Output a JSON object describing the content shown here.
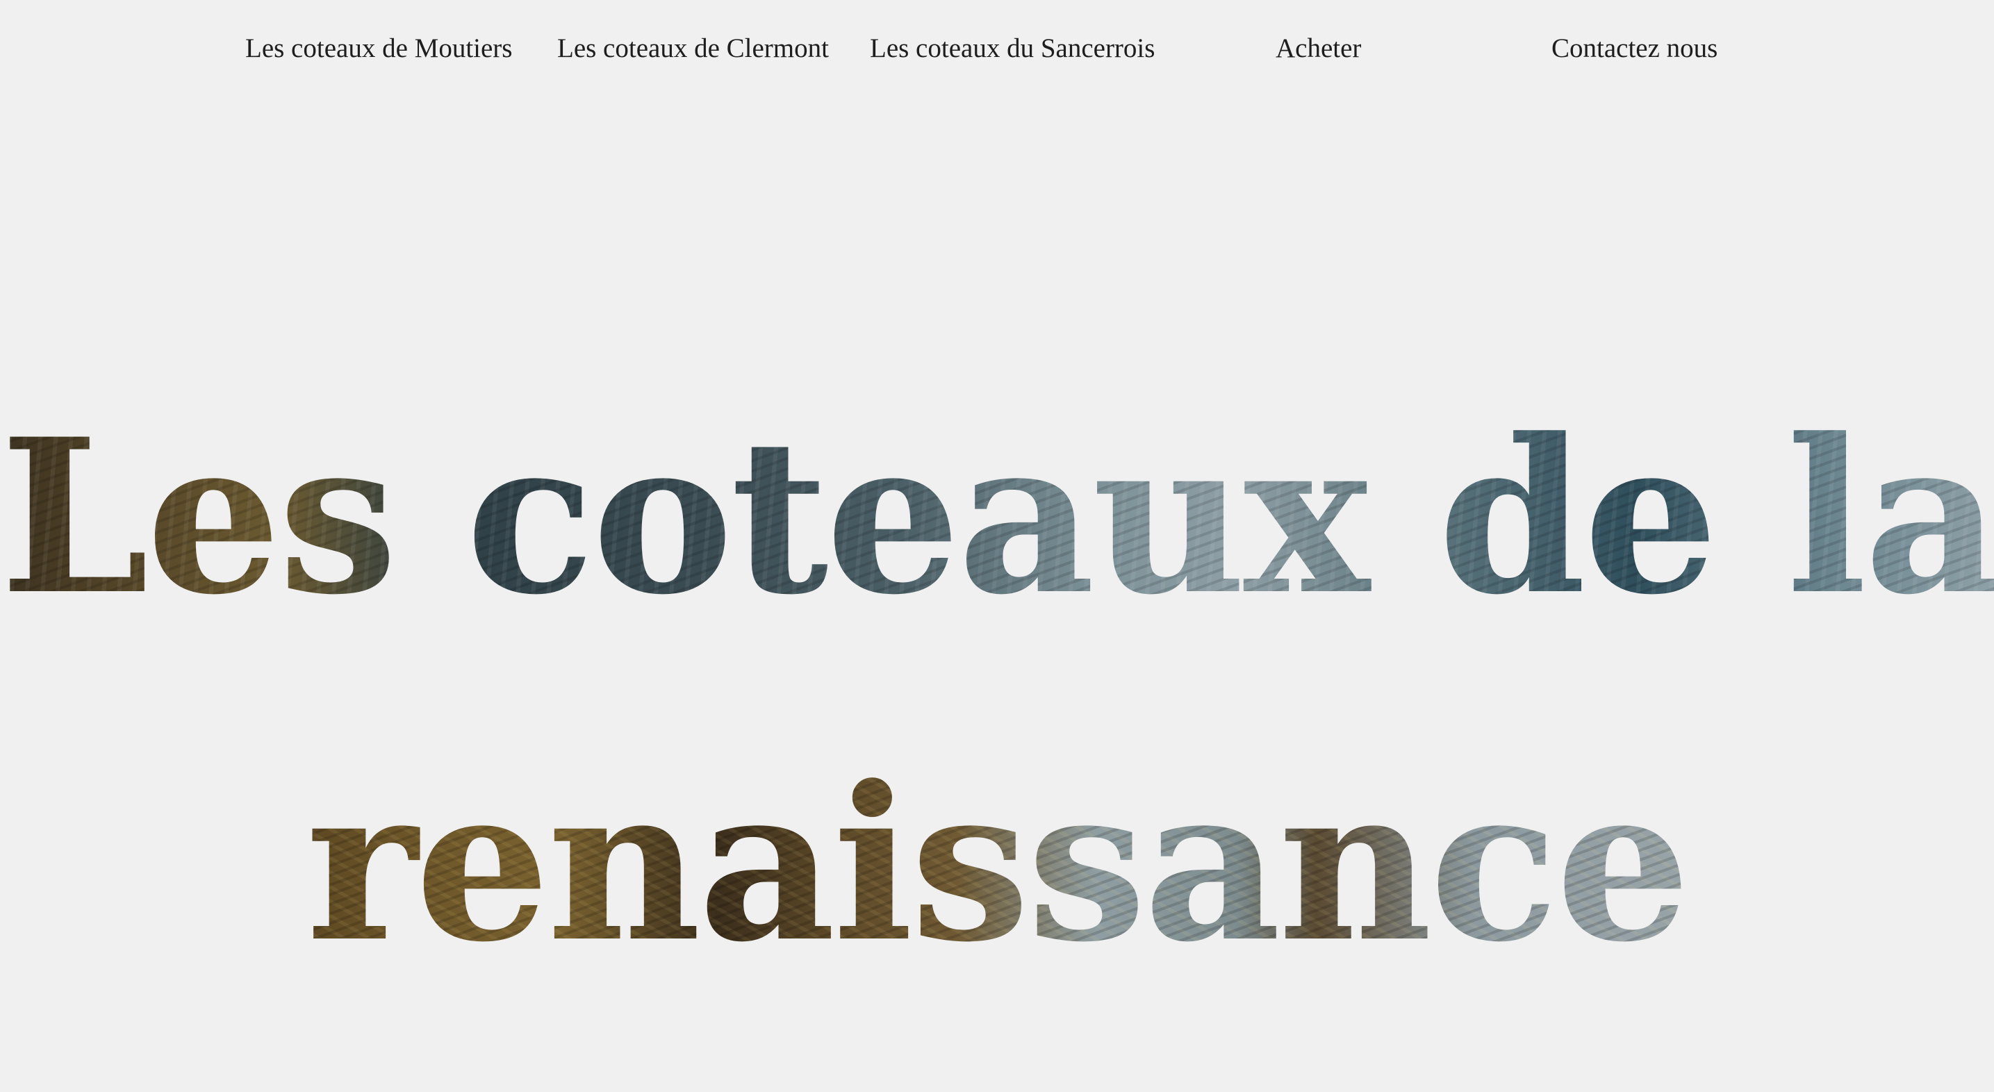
{
  "nav": {
    "items": [
      {
        "label": "Les coteaux de Moutiers"
      },
      {
        "label": "Les coteaux de Clermont"
      },
      {
        "label": "Les coteaux du Sancerrois"
      },
      {
        "label": "Acheter"
      },
      {
        "label": "Contactez nous"
      }
    ]
  },
  "hero": {
    "line1": "Les coteaux de la",
    "line2": "renaissance"
  }
}
